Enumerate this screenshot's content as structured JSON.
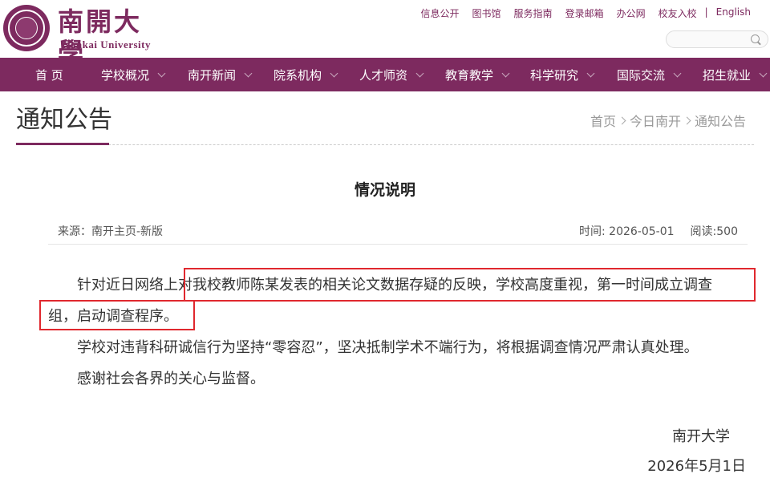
{
  "header": {
    "logo_cn": "南開大學",
    "logo_en": "Nankai University",
    "top_links": [
      "信息公开",
      "图书馆",
      "服务指南",
      "登录邮箱",
      "办公网",
      "校友入校"
    ],
    "lang_link": "English",
    "search_placeholder": ""
  },
  "nav": {
    "items": [
      {
        "label": "首 页"
      },
      {
        "label": "学校概况"
      },
      {
        "label": "南开新闻"
      },
      {
        "label": "院系机构"
      },
      {
        "label": "人才师资"
      },
      {
        "label": "教育教学"
      },
      {
        "label": "科学研究"
      },
      {
        "label": "国际交流"
      },
      {
        "label": "招生就业"
      }
    ],
    "bg_color": "#7d2a5f"
  },
  "page": {
    "title": "通知公告",
    "breadcrumb": [
      "首页",
      "今日南开",
      "通知公告"
    ]
  },
  "article": {
    "title": "情况说明",
    "source_label": "来源：南开主页-新版",
    "time_label": "时间: 2026-05-01",
    "reads_label": "阅读:500",
    "paragraph1_start": "针对近日网络上",
    "paragraph1_highlight": "对我校教师陈某发表的相关论文数据存疑的反映，学校高度重视，第一时间成立调查组，启动调查程序。",
    "paragraph2": "学校对违背科研诚信行为坚持“零容忍”，坚决抵制学术不端行为，将根据调查情况严肃认真处理。",
    "paragraph3": "感谢社会各界的关心与监督。",
    "signature": "南开大学",
    "date": "2026年5月1日"
  },
  "colors": {
    "accent": "#7d2a5f",
    "highlight_box": "#e0282e"
  }
}
